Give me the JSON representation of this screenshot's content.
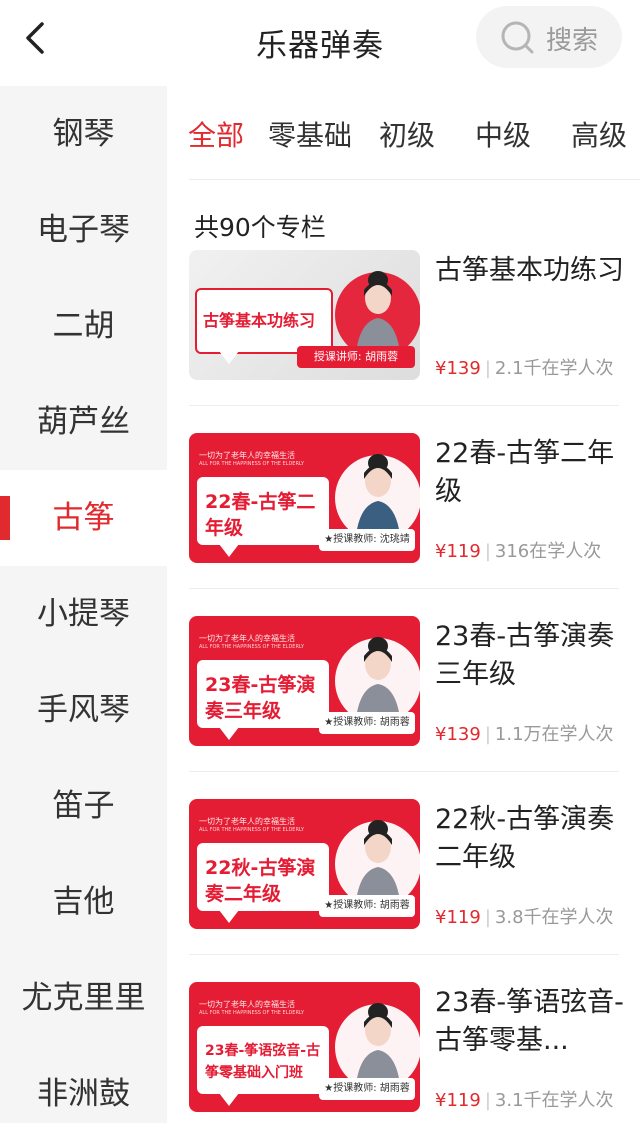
{
  "header": {
    "title": "乐器弹奏",
    "search_label": "搜索"
  },
  "sidebar": {
    "items": [
      {
        "label": "钢琴"
      },
      {
        "label": "电子琴"
      },
      {
        "label": "二胡"
      },
      {
        "label": "葫芦丝"
      },
      {
        "label": "古筝",
        "active": true
      },
      {
        "label": "小提琴"
      },
      {
        "label": "手风琴"
      },
      {
        "label": "笛子"
      },
      {
        "label": "吉他"
      },
      {
        "label": "尤克里里"
      },
      {
        "label": "非洲鼓"
      }
    ]
  },
  "tabs": [
    {
      "label": "全部",
      "active": true
    },
    {
      "label": "零基础"
    },
    {
      "label": "初级"
    },
    {
      "label": "中级"
    },
    {
      "label": "高级"
    }
  ],
  "count_text": "共90个专栏",
  "courses": [
    {
      "title": "古筝基本功练习",
      "thumb_title": "古筝基本功练习",
      "thumb_slogan": "",
      "thumb_slogan_en": "",
      "thumb_teacher": "授课讲师: 胡雨蓉",
      "price": "¥139",
      "learners": "2.1千在学人次"
    },
    {
      "title": "22春-古筝二年级",
      "thumb_title": "22春-古筝二年级",
      "thumb_slogan": "一切为了老年人的幸福生活",
      "thumb_slogan_en": "ALL FOR THE HAPPINESS OF THE ELDERLY",
      "thumb_teacher": "★授课教师: 沈珧靖",
      "price": "¥119",
      "learners": "316在学人次"
    },
    {
      "title": "23春-古筝演奏三年级",
      "thumb_title": "23春-古筝演奏三年级",
      "thumb_slogan": "一切为了老年人的幸福生活",
      "thumb_slogan_en": "ALL FOR THE HAPPINESS OF THE ELDERLY",
      "thumb_teacher": "★授课教师: 胡雨蓉",
      "price": "¥139",
      "learners": "1.1万在学人次"
    },
    {
      "title": "22秋-古筝演奏二年级",
      "thumb_title": "22秋-古筝演奏二年级",
      "thumb_slogan": "一切为了老年人的幸福生活",
      "thumb_slogan_en": "ALL FOR THE HAPPINESS OF THE ELDERLY",
      "thumb_teacher": "★授课教师: 胡雨蓉",
      "price": "¥119",
      "learners": "3.8千在学人次"
    },
    {
      "title": "23春-筝语弦音-古筝零基...",
      "thumb_title": "23春-筝语弦音-古筝零基础入门班",
      "thumb_slogan": "一切为了老年人的幸福生活",
      "thumb_slogan_en": "ALL FOR THE HAPPINESS OF THE ELDERLY",
      "thumb_teacher": "★授课教师: 胡雨蓉",
      "price": "¥119",
      "learners": "3.1千在学人次"
    }
  ]
}
